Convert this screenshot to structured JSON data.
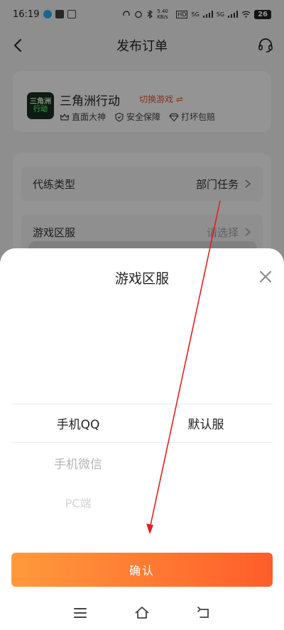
{
  "status_bar": {
    "time": "16:19",
    "network_speed": "5.40 KB/s",
    "net_a": "5G",
    "net_b": "5G",
    "battery": "26"
  },
  "nav": {
    "title": "发布订单"
  },
  "game": {
    "logo_line1": "三角洲",
    "logo_line2": "行动",
    "name": "三角洲行动",
    "switch_label": "切换游戏 ⇌",
    "tags": [
      "直面大神",
      "安全保障",
      "打坏包赔"
    ]
  },
  "form": {
    "row1_label": "代练类型",
    "row1_value": "部门任务",
    "row2_label": "游戏区服",
    "row2_placeholder": "请选择"
  },
  "sheet": {
    "title": "游戏区服",
    "left_options": [
      "手机QQ",
      "手机微信",
      "PC端"
    ],
    "right_options": [
      "默认服"
    ],
    "confirm_label": "确认"
  },
  "colors": {
    "accent_start": "#ff9a3c",
    "accent_end": "#ff5d2a",
    "switch_text": "#e65a3a",
    "annotation": "#e02020"
  }
}
